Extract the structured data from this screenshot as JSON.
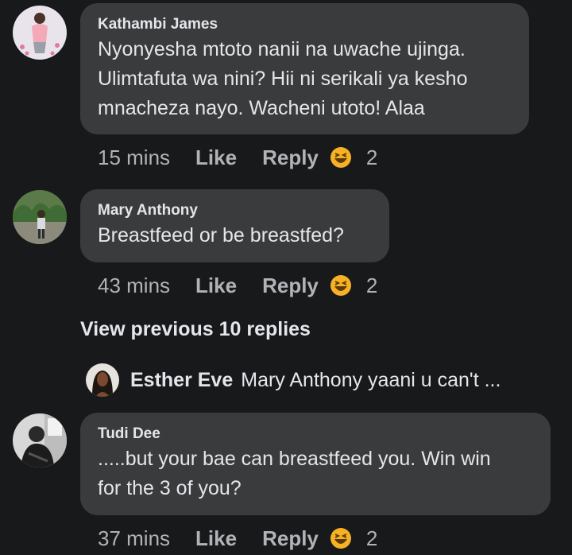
{
  "comments": [
    {
      "author": "Kathambi James",
      "lines": [
        "Nyonyesha mtoto nanii na uwache ujinga.",
        "Ulimtafuta wa nini? Hii ni serikali ya kesho",
        "mnacheza nayo. Wacheni utoto! Alaa"
      ],
      "time": "15 mins",
      "like_label": "Like",
      "reply_label": "Reply",
      "reaction_icon": "laughing-emoji-icon",
      "reaction_count": "2"
    },
    {
      "author": "Mary Anthony",
      "lines": [
        "Breastfeed or be breastfed?"
      ],
      "time": "43 mins",
      "like_label": "Like",
      "reply_label": "Reply",
      "reaction_icon": "laughing-emoji-icon",
      "reaction_count": "2"
    },
    {
      "author": "Tudi Dee",
      "lines": [
        ".....but your bae can breastfeed you. Win win",
        "for the 3 of you?"
      ],
      "time": "37 mins",
      "like_label": "Like",
      "reply_label": "Reply",
      "reaction_icon": "laughing-emoji-icon",
      "reaction_count": "2"
    }
  ],
  "view_previous": "View previous 10 replies",
  "reply_preview": {
    "name": "Esther Eve",
    "text": "Mary Anthony yaani u can't ..."
  },
  "colors": {
    "background": "#18191a",
    "bubble": "#3a3b3c",
    "primary_text": "#e4e6eb",
    "secondary_text": "#b0b3b8",
    "emoji_yellow": "#f7b125"
  }
}
